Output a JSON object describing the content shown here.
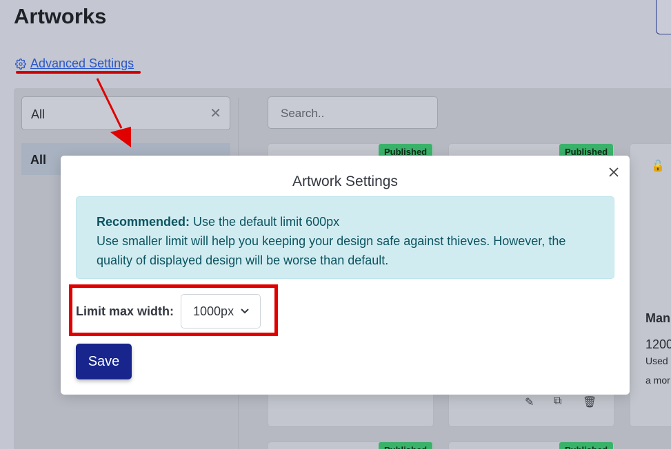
{
  "page": {
    "title": "Artworks",
    "advanced_settings_label": "Advanced Settings"
  },
  "sidebar": {
    "filter_value": "All",
    "items": [
      {
        "label": "All"
      }
    ]
  },
  "search": {
    "placeholder": "Search.."
  },
  "cards": {
    "badge": "Published",
    "partial_title": "Man",
    "partial_size": "1200",
    "partial_line1": "Used",
    "partial_line2": "a mor"
  },
  "modal": {
    "title": "Artwork Settings",
    "alert_strong": "Recommended:",
    "alert_lead": " Use the default limit 600px",
    "alert_body": "Use smaller limit will help you keeping your design safe against thieves. However, the quality of displayed design will be worse than default.",
    "limit_label": "Limit max width:",
    "limit_value": "1000px",
    "save_label": "Save"
  },
  "colors": {
    "accent": "#17258c",
    "link": "#2a57c9",
    "annotation_red": "#e00000",
    "badge_green": "#3ab26a",
    "alert_bg": "#d1ecf1"
  }
}
